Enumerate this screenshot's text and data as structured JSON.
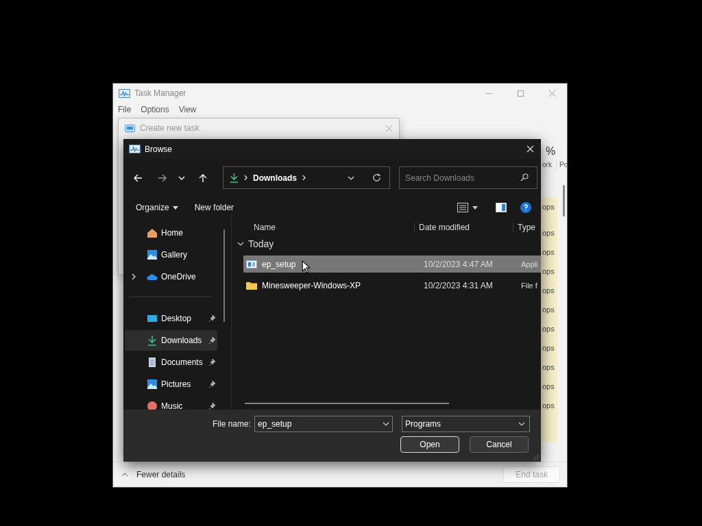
{
  "task_manager": {
    "title": "Task Manager",
    "menu": [
      "File",
      "Options",
      "View"
    ],
    "header_fragments": [
      "%",
      "ork",
      "Po"
    ],
    "column_fragments": [
      "ops",
      "ops",
      "ops",
      "ops",
      "ops",
      "ops",
      "ops",
      "ops",
      "ops",
      "ops",
      "ops"
    ],
    "fewer_details": "Fewer details",
    "end_task": {
      "label": "End task",
      "disabled": true
    }
  },
  "create_task": {
    "title": "Create new task"
  },
  "browse": {
    "title": "Browse",
    "path": [
      "Downloads"
    ],
    "search": {
      "placeholder": "Search Downloads"
    },
    "organize": "Organize",
    "new_folder": "New folder",
    "sidebar_top": [
      {
        "label": "Home",
        "pinned": false,
        "selected": false,
        "expandable": false
      },
      {
        "label": "Gallery",
        "pinned": false,
        "selected": false,
        "expandable": false
      },
      {
        "label": "OneDrive",
        "pinned": false,
        "selected": false,
        "expandable": true
      }
    ],
    "sidebar_bottom": [
      {
        "label": "Desktop",
        "pinned": true,
        "selected": false,
        "expandable": false
      },
      {
        "label": "Downloads",
        "pinned": true,
        "selected": true,
        "expandable": false
      },
      {
        "label": "Documents",
        "pinned": true,
        "selected": false,
        "expandable": false
      },
      {
        "label": "Pictures",
        "pinned": true,
        "selected": false,
        "expandable": false
      },
      {
        "label": "Music",
        "pinned": true,
        "selected": false,
        "expandable": false
      }
    ],
    "columns": [
      "Name",
      "Date modified",
      "Type"
    ],
    "groups": [
      {
        "label": "Today",
        "expanded": true,
        "files": [
          {
            "name": "ep_setup",
            "kind": "app",
            "date": "10/2/2023 4:47 AM",
            "type": "Appli",
            "selected": true
          },
          {
            "name": "Minesweeper-Windows-XP",
            "kind": "folder",
            "date": "10/2/2023 4:31 AM",
            "type": "File f",
            "selected": false
          }
        ]
      }
    ],
    "file_name_label": "File name:",
    "file_name": "ep_setup",
    "file_type": "Programs",
    "open": "Open",
    "cancel": "Cancel"
  }
}
